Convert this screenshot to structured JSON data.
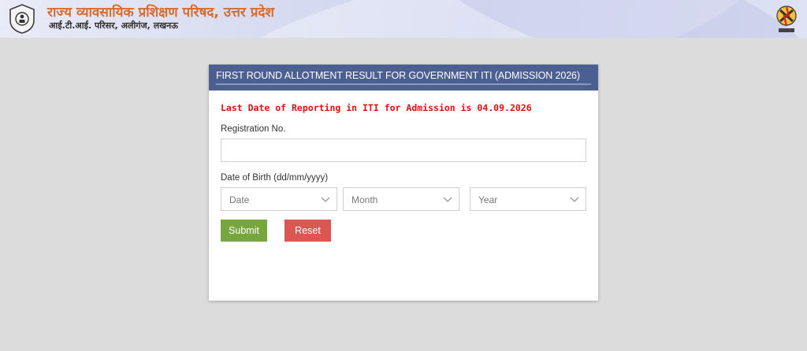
{
  "header": {
    "title": "राज्य व्यावसायिक प्रशिक्षण परिषद, उत्तर प्रदेश",
    "subtitle": "आई.टी.आई. परिसर, अलीगंज, लखनऊ"
  },
  "panel": {
    "heading": "FIRST ROUND ALLOTMENT RESULT FOR GOVERNMENT ITI (ADMISSION 2026)",
    "notice": "Last Date of Reporting in ITI for Admission is 04.09.2026",
    "registration_label": "Registration No.",
    "registration_value": "",
    "dob_label": "Date of Birth (dd/mm/yyyy)",
    "date_select": "Date",
    "month_select": "Month",
    "year_select": "Year",
    "submit_label": "Submit",
    "reset_label": "Reset"
  },
  "colors": {
    "panel_header": "#4b5f91",
    "notice": "#e10f0f",
    "submit": "#77a63e",
    "reset": "#dc5653",
    "title": "#d86a2c"
  },
  "icons": {
    "left_logo": "emblem-logo",
    "right_logo": "ncvt-logo",
    "select_arrow": "chevron-down-icon"
  }
}
